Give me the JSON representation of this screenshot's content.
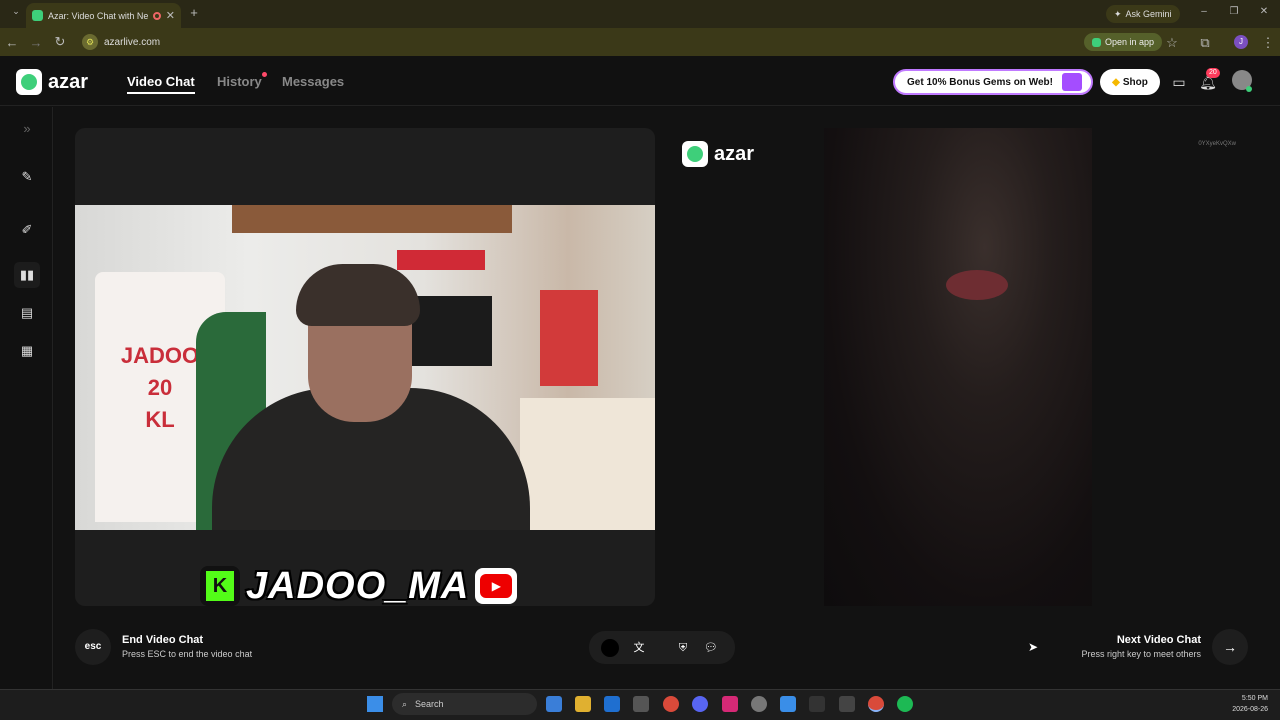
{
  "browser": {
    "tab_title": "Azar: Video Chat with New",
    "url": "azarlive.com",
    "ask_gemini": "Ask Gemini",
    "open_in_app": "Open in app"
  },
  "app": {
    "logo_text": "azar",
    "nav": [
      {
        "label": "Video Chat"
      },
      {
        "label": "History"
      },
      {
        "label": "Messages"
      }
    ],
    "bonus_label": "Get 10% Bonus Gems on Web!",
    "shop_label": "Shop",
    "notification_count": "20"
  },
  "video": {
    "jersey_text": "JADOO\n20\nKL",
    "streamer_handle": "JADOO_MA",
    "remote_id": "0YXyeKvQXw",
    "remote_logo": "azar"
  },
  "controls": {
    "end_title": "End Video Chat",
    "end_sub": "Press ESC to end the video chat",
    "esc_label": "esc",
    "next_title": "Next Video Chat",
    "next_sub": "Press right key to meet others"
  },
  "taskbar": {
    "search_label": "Search",
    "time": "5:50 PM",
    "date": "2026-08-26"
  },
  "colors": {
    "accent_green": "#3ecf7a",
    "bonus_border": "#c07aff",
    "badge_red": "#ff3b5c"
  }
}
